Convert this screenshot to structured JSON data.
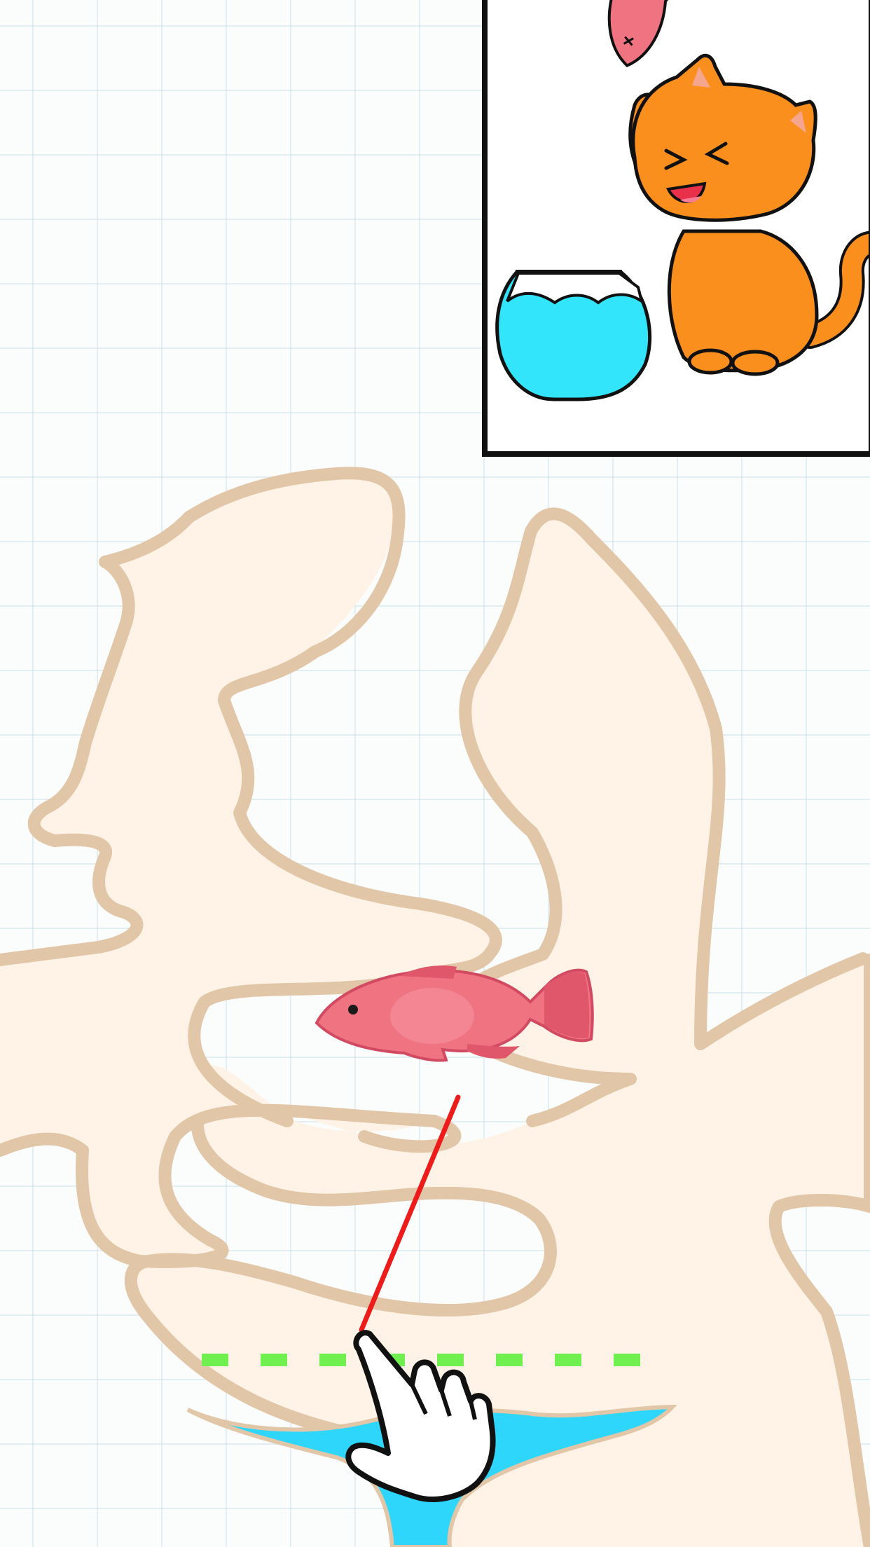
{
  "level": {
    "goal": "fish-to-bowl",
    "colors": {
      "grid_background": "#fbfcfc",
      "grid_lines": "#c6dde6",
      "maze_fill": "#fff3e7",
      "maze_outline": "#e2c6a8",
      "water": "#2ed6fb",
      "fish_body": "#f07382",
      "fish_fin": "#e0566b",
      "guide_dashes": "#6ff04f",
      "drawn_line": "#ee1b1b",
      "cat": "#fa8f1d",
      "bowl_water": "#33e5fb",
      "panel_border": "#111111"
    }
  },
  "hint_panel": {
    "description_icons": [
      "cat-icon",
      "fish-icon",
      "fishbowl-icon"
    ]
  },
  "board": {
    "icons": [
      "fish-icon",
      "hand-pointer-icon",
      "water-pool"
    ],
    "guide_line_style": "dashed",
    "drawn_line_state": "drawing"
  }
}
